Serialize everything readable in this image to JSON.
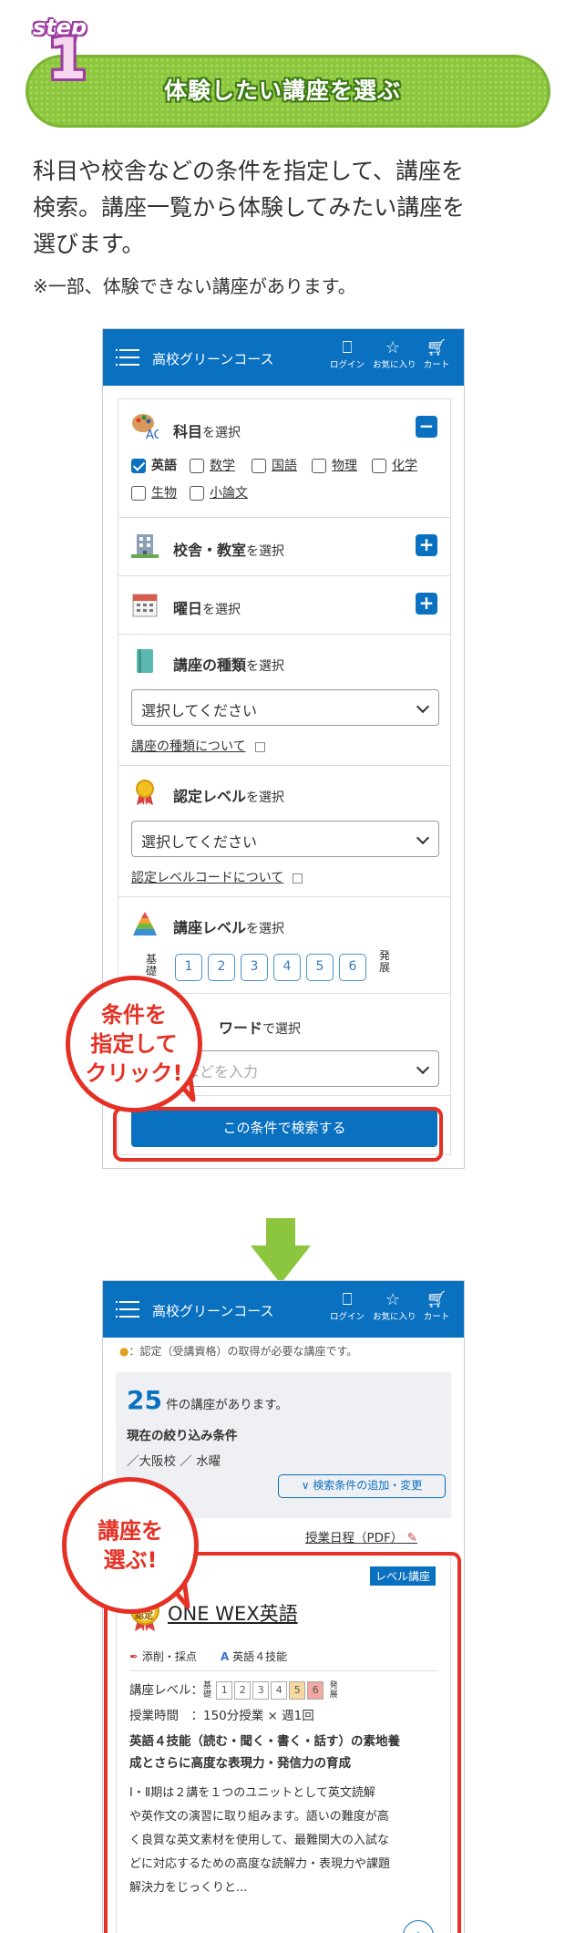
{
  "step": {
    "word": "step",
    "number": "1",
    "title": "体験したい講座を選ぶ"
  },
  "intro": {
    "line1": "科目や校舎などの条件を指定して、講座を",
    "line2": "検索。講座一覧から体験してみたい講座を",
    "line3": "選びます。",
    "note": "※一部、体験できない講座があります。"
  },
  "app": {
    "title": "高校グリーンコース",
    "login": "ログイン",
    "favorites": "お気に入り",
    "cart": "カート"
  },
  "search_form": {
    "subject": {
      "title": "科目",
      "suffix": "を選択",
      "toggle": "−",
      "options": [
        {
          "label": "英語",
          "checked": true
        },
        {
          "label": "数学",
          "checked": false
        },
        {
          "label": "国語",
          "checked": false
        },
        {
          "label": "物理",
          "checked": false
        },
        {
          "label": "化学",
          "checked": false
        },
        {
          "label": "生物",
          "checked": false
        },
        {
          "label": "小論文",
          "checked": false
        }
      ]
    },
    "school": {
      "title": "校舎・教室",
      "suffix": "を選択",
      "toggle": "+"
    },
    "day": {
      "title": "曜日",
      "suffix": "を選択",
      "toggle": "+"
    },
    "course_type": {
      "title": "講座の種類",
      "suffix": "を選択",
      "select_value": "選択してください",
      "link": "講座の種類について"
    },
    "cert_level": {
      "title": "認定レベル",
      "suffix": "を選択",
      "select_value": "選択してください",
      "link": "認定レベルコードについて"
    },
    "course_level": {
      "title": "講座レベル",
      "suffix": "を選択",
      "low": "基礎",
      "high": "発展",
      "levels": [
        "1",
        "2",
        "3",
        "4",
        "5",
        "6"
      ]
    },
    "keyword": {
      "title": "ワード",
      "suffix": "で選択",
      "placeholder": "講師名などを入力"
    },
    "search_button": "この条件で検索する"
  },
  "callout1": {
    "line1": "条件を",
    "line2": "指定して",
    "line3": "クリック!"
  },
  "results": {
    "cert_note": "：認定（受講資格）の取得が必要な講座です。",
    "count": "25",
    "count_suffix": "件の講座があります。",
    "filter_label": "現在の絞り込み条件",
    "filter_value": "／大阪校 ／ 水曜",
    "add_button": "検索条件の追加・変更",
    "schedule_link": "授業日程（PDF）"
  },
  "callout2": {
    "line1": "講座を",
    "line2": "選ぶ!"
  },
  "course": {
    "tag": "レベル講座",
    "badge": "認定",
    "name": "ONE WEX英語",
    "feature1": "添削・採点",
    "feature2": "英語４技能",
    "level_label": "講座レベル：",
    "level_low": "基礎",
    "level_high": "発展",
    "levels": [
      "1",
      "2",
      "3",
      "4",
      "5",
      "6"
    ],
    "highlight_levels": [
      "5",
      "6"
    ],
    "time_label": "授業時間",
    "time_value": "：150分授業 × 週1回",
    "headline1": "英語４技能（読む・聞く・書く・話す）の素地養",
    "headline2": "成とさらに高度な表現力・発信力の育成",
    "desc": [
      "Ⅰ・Ⅱ期は２講を１つのユニットとして英文読解",
      "や英作文の演習に取り組みます。語いの難度が高",
      "く良質な英文素材を使用して、最難関大の入試な",
      "どに対応するための高度な読解力・表現力や課題",
      "解決力をじっくりと..."
    ]
  },
  "colors": {
    "brand_blue": "#0a70c0",
    "callout_red": "#e53125",
    "banner_green": "#8cc63f"
  }
}
